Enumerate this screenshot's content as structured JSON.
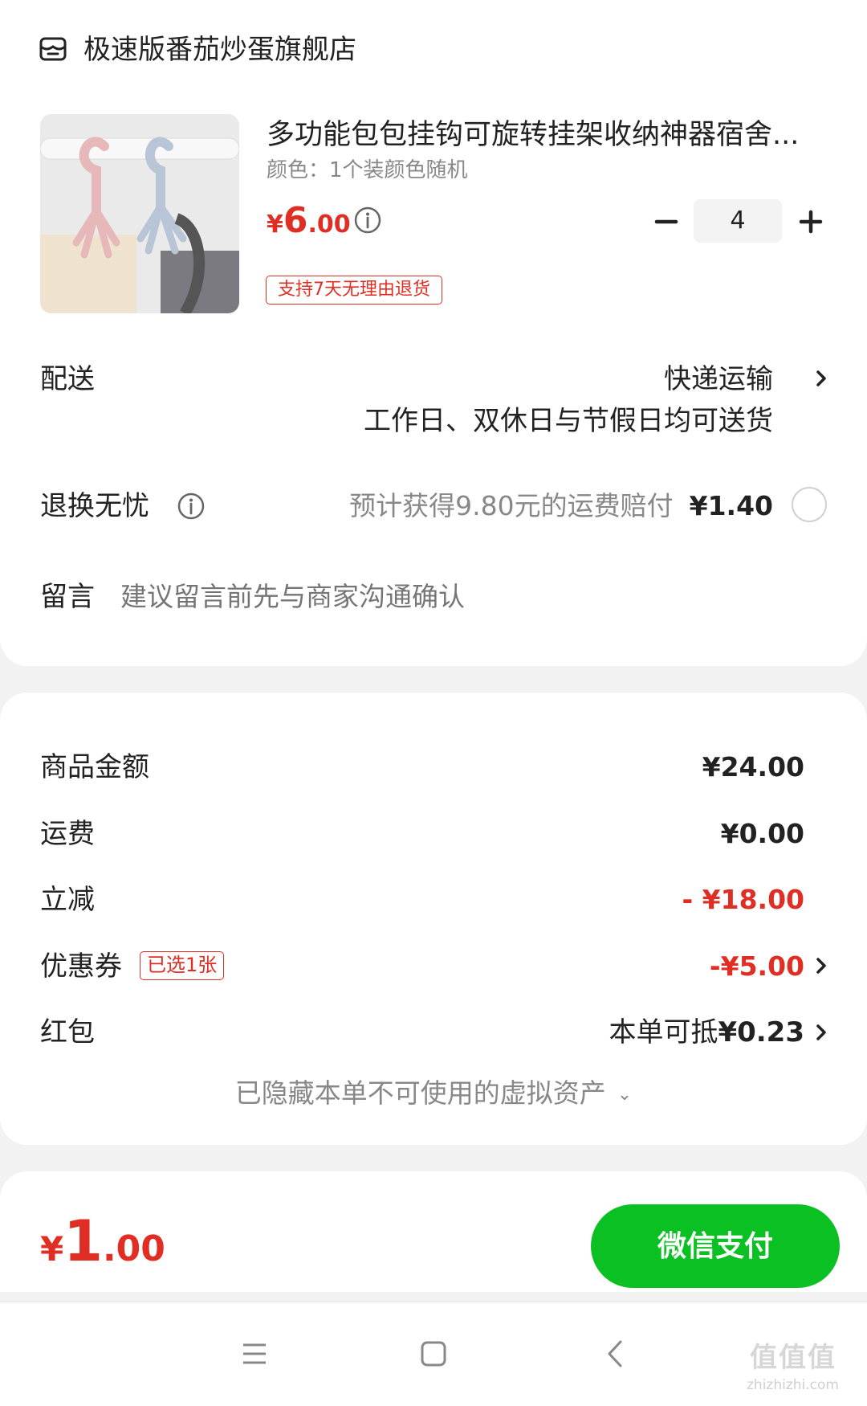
{
  "shop": {
    "name": "极速版番茄炒蛋旗舰店",
    "icon": "store-icon"
  },
  "product": {
    "title": "多功能包包挂钩可旋转挂架收纳神器宿舍...",
    "spec": "颜色：1个装颜色随机",
    "price_symbol": "¥",
    "price_int": "6",
    "price_dec": ".00",
    "quantity": "4",
    "return_badge": "支持7天无理由退货"
  },
  "delivery": {
    "label": "配送",
    "method": "快递运输",
    "note": "工作日、双休日与节假日均可送货"
  },
  "return_worry": {
    "label": "退换无忧",
    "text": "预计获得9.80元的运费赔付",
    "price": "¥1.40"
  },
  "message": {
    "label": "留言",
    "placeholder": "建议留言前先与商家沟通确认"
  },
  "summary": {
    "goods_label": "商品金额",
    "goods_value": "¥24.00",
    "shipping_label": "运费",
    "shipping_value": "¥0.00",
    "discount_label": "立减",
    "discount_value": "- ¥18.00",
    "coupon_label": "优惠券",
    "coupon_badge": "已选1张",
    "coupon_value": "-¥5.00",
    "redpacket_label": "红包",
    "redpacket_prefix": "本单可抵",
    "redpacket_value": "¥0.23",
    "hidden_assets": "已隐藏本单不可使用的虚拟资产"
  },
  "pay": {
    "total_symbol": "¥",
    "total_int": "1",
    "total_dec": ".00",
    "button_label": "微信支付"
  },
  "watermark": {
    "main": "值值值",
    "sub": "zhizhizhi.com"
  },
  "colors": {
    "accent_red": "#e02e24",
    "pay_green": "#0bc022"
  }
}
